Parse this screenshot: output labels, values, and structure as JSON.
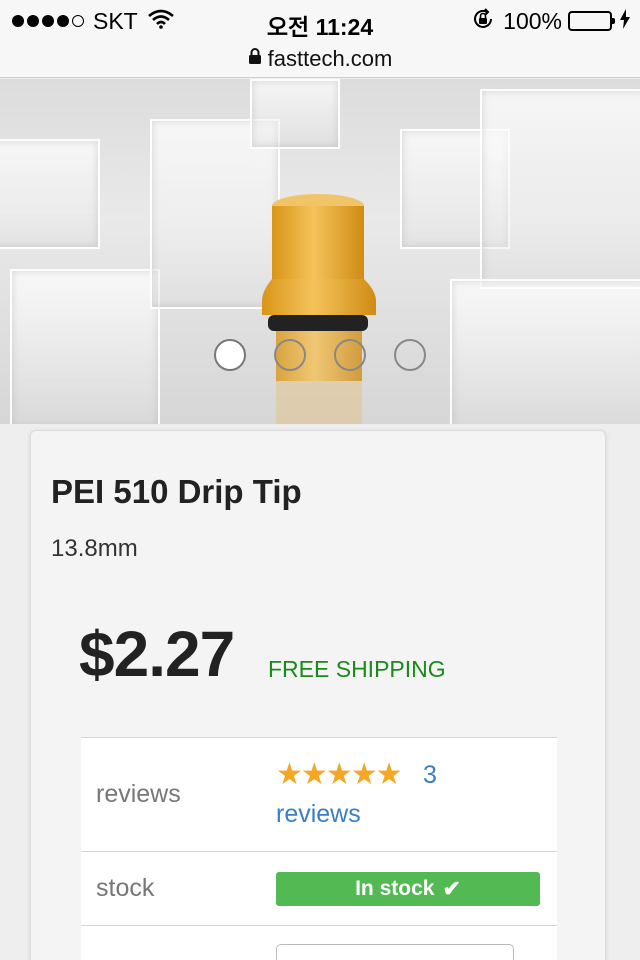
{
  "status_bar": {
    "carrier": "SKT",
    "time": "오전 11:24",
    "battery_percent": "100%",
    "battery_level": 1.0,
    "signal_bars_filled": 4,
    "signal_bars_total": 5
  },
  "url_bar": {
    "url": "fasttech.com"
  },
  "carousel": {
    "slide_count": 4,
    "active_index": 0
  },
  "product": {
    "title": "PEI 510 Drip Tip",
    "subtitle": "13.8mm",
    "price": "$2.27",
    "shipping": "FREE SHIPPING"
  },
  "specs": {
    "reviews_label": "reviews",
    "rating_stars": 5,
    "review_count": "3",
    "review_word": "reviews",
    "stock_label": "stock",
    "stock_status": "In stock"
  },
  "colors": {
    "shipping_green": "#1a8a1a",
    "stock_badge": "#53b953",
    "link_blue": "#3a7fc1",
    "star_orange": "#f5a623",
    "battery_green": "#4cd964"
  }
}
